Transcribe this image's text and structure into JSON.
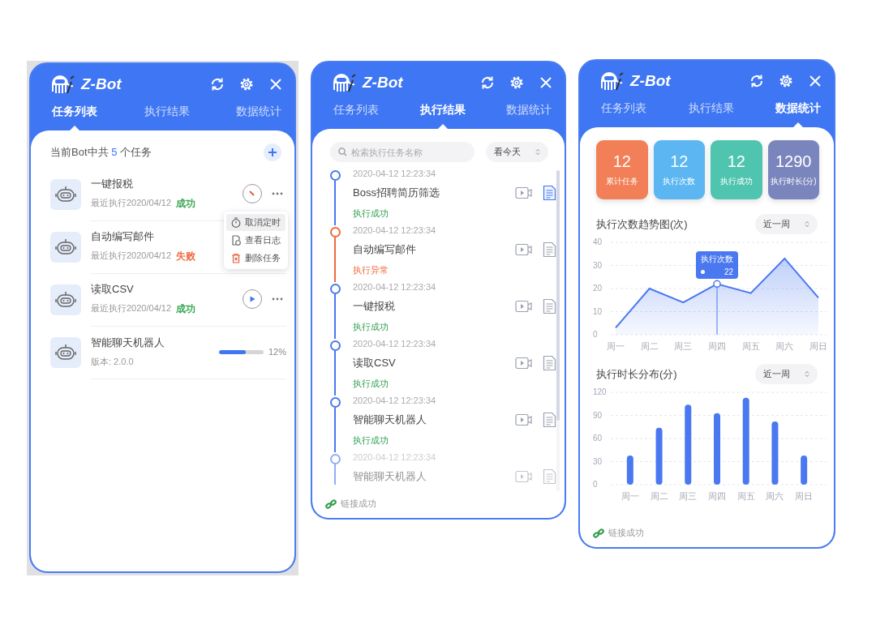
{
  "panels": [
    {
      "kind": "tasks",
      "app": {
        "name": "Z-Bot"
      },
      "tabs": [
        {
          "label": "任务列表",
          "selected": true
        },
        {
          "label": "执行结果",
          "selected": false
        },
        {
          "label": "数据统计",
          "selected": false
        }
      ],
      "summary": "当前Bot中共 **5** 个任务",
      "tasks": [
        {
          "kind": "scheduled",
          "name": "一键报税",
          "meta": "最近执行2020/04/12",
          "status": "成功",
          "color": "#3aa757"
        },
        {
          "kind": "plain",
          "name": "自动编写邮件",
          "meta": "最近执行2020/04/12",
          "status": "失败",
          "color": "#f06a3d"
        },
        {
          "kind": "idle",
          "name": "读取CSV",
          "meta": "最近执行2020/04/12",
          "status": "成功",
          "color": "#3aa757"
        },
        {
          "kind": "installing",
          "name": "智能聊天机器人",
          "meta": "版本: 2.0.0",
          "level": 0.6,
          "reading": "12%"
        }
      ],
      "menu": [
        {
          "kind": "timer",
          "label": "取消定时",
          "selected": true
        },
        {
          "kind": "log",
          "label": "查看日志",
          "selected": false
        },
        {
          "kind": "delete",
          "label": "删除任务",
          "selected": false
        }
      ]
    },
    {
      "kind": "results",
      "app": {
        "name": "Z-Bot"
      },
      "tabs": [
        {
          "label": "任务列表",
          "selected": false
        },
        {
          "label": "执行结果",
          "selected": true
        },
        {
          "label": "数据统计",
          "selected": false
        }
      ],
      "search": {
        "placeholder": "检索执行任务名称"
      },
      "filter": "看今天",
      "records": [
        {
          "kind": "success",
          "time": "2020-04-12 12:23:34",
          "name": "Boss招聘简历筛选",
          "status": "执行成功",
          "selected": true
        },
        {
          "kind": "failure",
          "time": "2020-04-12 12:23:34",
          "name": "自动编写邮件",
          "status": "执行异常",
          "selected": false
        },
        {
          "kind": "success",
          "time": "2020-04-12 12:23:34",
          "name": "一键报税",
          "status": "执行成功",
          "selected": false
        },
        {
          "kind": "success",
          "time": "2020-04-12 12:23:34",
          "name": "读取CSV",
          "status": "执行成功",
          "selected": false
        },
        {
          "kind": "success",
          "time": "2020-04-12 12:23:34",
          "name": "智能聊天机器人",
          "status": "执行成功",
          "selected": false
        },
        {
          "kind": "success",
          "time": "2020-04-12 12:23:34",
          "name": "智能聊天机器人",
          "selected": false
        }
      ],
      "footer": "链接成功"
    },
    {
      "kind": "stats",
      "app": {
        "name": "Z-Bot"
      },
      "tabs": [
        {
          "label": "任务列表",
          "selected": false
        },
        {
          "label": "执行结果",
          "selected": false
        },
        {
          "label": "数据统计",
          "selected": true
        }
      ],
      "stats": [
        {
          "value": "12",
          "label": "累计任务",
          "color": "#f27f57"
        },
        {
          "value": "12",
          "label": "执行次数",
          "color": "#5bb6f2"
        },
        {
          "value": "12",
          "label": "执行成功",
          "color": "#4fc4ae"
        },
        {
          "value": "1290",
          "label": "执行时长(分)",
          "color": "#7b85bd"
        }
      ],
      "charts": [
        {
          "title": "执行次数趋势图(次)",
          "range": "近一周",
          "chart_data": {
            "type": "area",
            "categories": [
              "周一",
              "周二",
              "周三",
              "周四",
              "周五",
              "周六",
              "周日"
            ],
            "series": [
              {
                "name": "执行次数",
                "color": "#4a78f0",
                "values": [
                  3,
                  20,
                  14,
                  22,
                  18,
                  33,
                  16
                ]
              }
            ],
            "ylim": [
              0,
              40
            ],
            "yticks": [
              0,
              10,
              20,
              30,
              40
            ],
            "grid": true,
            "annotations": [
              "22"
            ]
          }
        },
        {
          "title": "执行时长分布(分)",
          "range": "近一周",
          "chart_data": {
            "type": "bar",
            "categories": [
              "周一",
              "周二",
              "周三",
              "周四",
              "周五",
              "周六",
              "周日"
            ],
            "series": [
              {
                "color": "#4a78f0",
                "values": [
                  38,
                  74,
                  104,
                  93,
                  113,
                  82,
                  38
                ]
              }
            ],
            "ylim": [
              0,
              120
            ],
            "yticks": [
              0,
              30,
              60,
              90,
              120
            ],
            "grid": true
          }
        }
      ],
      "footer": "链接成功"
    }
  ]
}
